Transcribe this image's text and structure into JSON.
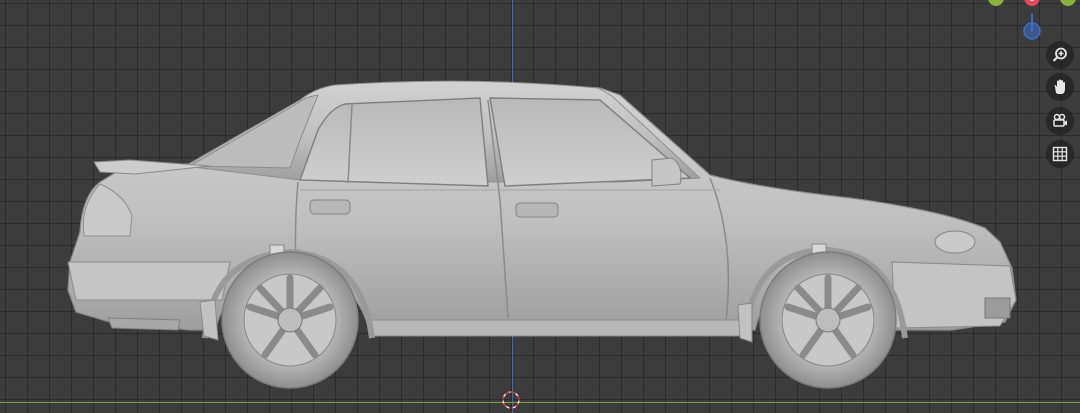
{
  "viewport": {
    "background_color": "#3c3c3c",
    "grid_color": "#2e2e2e",
    "axis_colors": {
      "x": "#7aa23a",
      "y": "#7aa23a",
      "z": "#3d6fb8"
    }
  },
  "gizmo": {
    "axes": [
      {
        "name": "x-axis-handle",
        "color": "#8bb13e"
      },
      {
        "name": "z-axis-handle",
        "color": "#e04a5a"
      },
      {
        "name": "y-axis-handle",
        "color": "#8bb13e"
      },
      {
        "name": "neg-y-axis-handle",
        "color": "#3a6fc6"
      }
    ]
  },
  "navigation_controls": [
    {
      "name": "zoom-icon",
      "icon": "magnifier-plus"
    },
    {
      "name": "pan-hand-icon",
      "icon": "hand"
    },
    {
      "name": "camera-view-icon",
      "icon": "camera"
    },
    {
      "name": "grid-toggle-icon",
      "icon": "grid"
    }
  ],
  "model": {
    "name": "sedan-model",
    "body_color": "#c3c3c3"
  }
}
